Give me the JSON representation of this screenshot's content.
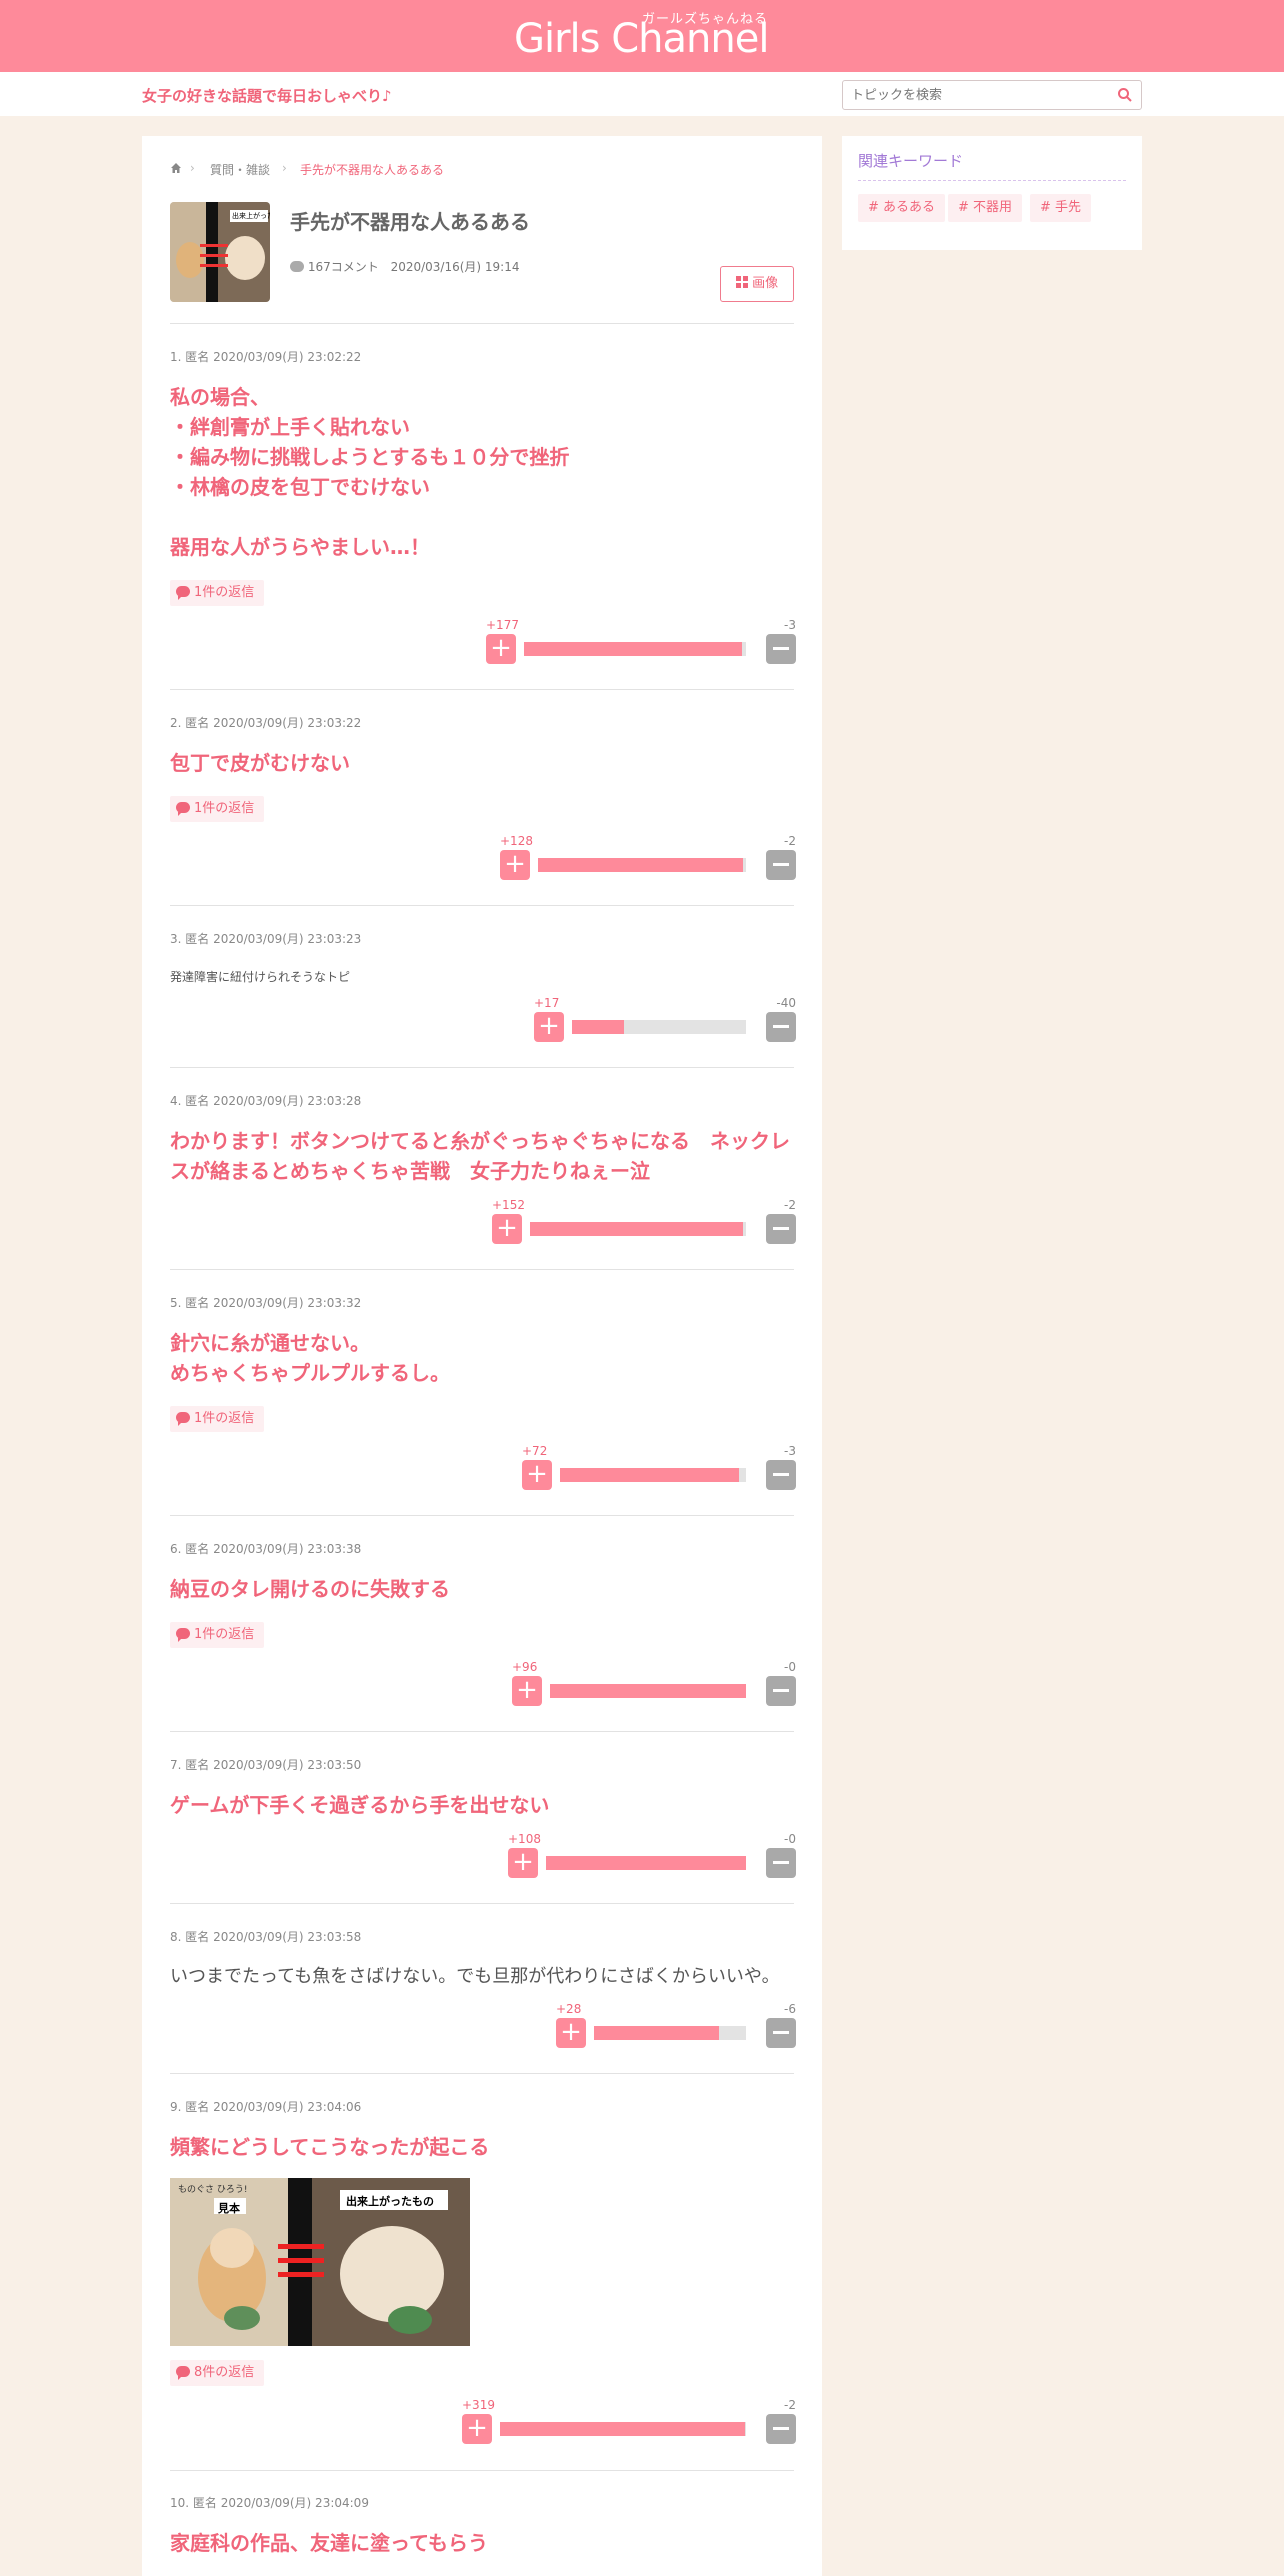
{
  "header": {
    "logo_text": "Girls Channel",
    "logo_kana": "ガールズちゃんねる",
    "tagline": "女子の好きな話題で毎日おしゃべり♪",
    "search_placeholder": "トピックを検索"
  },
  "breadcrumb": [
    "質問・雑談",
    "手先が不器用な人あるある"
  ],
  "topic": {
    "title": "手先が不器用な人あるある",
    "comment_count": "167コメント",
    "date": "2020/03/16(月) 19:14",
    "image_button": "画像",
    "thumb_caption": "出来上がったもの"
  },
  "sidebar": {
    "title": "関連キーワード",
    "keywords": [
      "# あるある",
      "# 不器用",
      "# 手先"
    ]
  },
  "comments": [
    {
      "meta": "1. 匿名 2020/03/09(月) 23:02:22",
      "lines": [
        "私の場合、",
        "・絆創膏が上手く貼れない",
        "・編み物に挑戦しようとするも１０分で挫折",
        "・林檎の皮を包丁でむけない",
        "",
        "器用な人がうらやましい…！"
      ],
      "reply": "1件の返信",
      "plus": "+177",
      "minus": "-3",
      "plus_share": 0.983
    },
    {
      "meta": "2. 匿名 2020/03/09(月) 23:03:22",
      "lines": [
        "包丁で皮がむけない"
      ],
      "reply": "1件の返信",
      "plus": "+128",
      "minus": "-2",
      "plus_share": 0.985
    },
    {
      "meta": "3. 匿名 2020/03/09(月) 23:03:23",
      "lines": [
        "発達障害に紐付けられそうなトピ"
      ],
      "plus": "+17",
      "minus": "-40",
      "plus_share": 0.298
    },
    {
      "meta": "4. 匿名 2020/03/09(月) 23:03:28",
      "lines": [
        "わかります！ボタンつけてると糸がぐっちゃぐちゃになる　ネックレ",
        "スが絡まるとめちゃくちゃ苦戦　女子力たりねぇー泣"
      ],
      "plus": "+152",
      "minus": "-2",
      "plus_share": 0.987
    },
    {
      "meta": "5. 匿名 2020/03/09(月) 23:03:32",
      "lines": [
        "針穴に糸が通せない。",
        "めちゃくちゃプルプルするし。"
      ],
      "reply": "1件の返信",
      "plus": "+72",
      "minus": "-3",
      "plus_share": 0.96
    },
    {
      "meta": "6. 匿名 2020/03/09(月) 23:03:38",
      "lines": [
        "納豆のタレ開けるのに失敗する"
      ],
      "reply": "1件の返信",
      "plus": "+96",
      "minus": "-0",
      "plus_share": 1.0
    },
    {
      "meta": "7. 匿名 2020/03/09(月) 23:03:50",
      "lines": [
        "ゲームが下手くそ過ぎるから手を出せない"
      ],
      "plus": "+108",
      "minus": "-0",
      "plus_share": 1.0
    },
    {
      "meta": "8. 匿名 2020/03/09(月) 23:03:58",
      "lines": [
        "いつまでたっても魚をさばけない。でも旦那が代わりにさばくからいいや。"
      ],
      "plus": "+28",
      "minus": "-6",
      "plus_share": 0.824
    },
    {
      "meta": "9. 匿名 2020/03/09(月) 23:04:06",
      "lines": [
        "頻繁にどうしてこうなったが起こる"
      ],
      "image_labels": [
        "見本",
        "出来上がったもの",
        "ものぐさ ひろう!"
      ],
      "reply": "8件の返信",
      "plus": "+319",
      "minus": "-2",
      "plus_share": 0.994
    },
    {
      "meta": "10. 匿名 2020/03/09(月) 23:04:09",
      "lines": [
        "家庭科の作品、友達に塗ってもらう"
      ]
    }
  ],
  "colors": {
    "brand": "#fe8a9a",
    "accent_text": "#f0657a",
    "background": "#f9f0e7",
    "keyword_title": "#a279d6"
  }
}
